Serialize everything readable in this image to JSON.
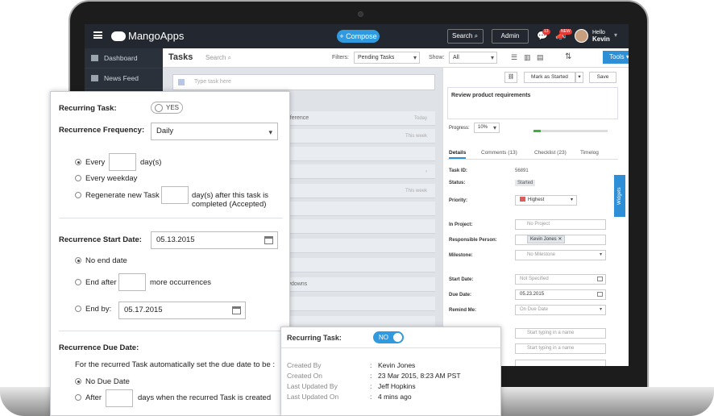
{
  "topbar": {
    "logo": "MangoApps",
    "compose": "+ Compose",
    "search": "Search",
    "admin": "Admin",
    "badge_chat": "13",
    "badge_new": "NEW",
    "hello": "Hello",
    "user": "Kevin"
  },
  "sidebar": {
    "items": [
      {
        "label": "Dashboard"
      },
      {
        "label": "News Feed"
      }
    ]
  },
  "tasks": {
    "title": "Tasks",
    "search_placeholder": "Search",
    "filters_label": "Filters:",
    "filter_value": "Pending Tasks",
    "show_label": "Show:",
    "show_value": "All",
    "tools": "Tools",
    "add_placeholder": "Type task here",
    "rows": [
      {
        "text": "onference",
        "due": "Today"
      },
      {
        "text": "",
        "due": "This week"
      },
      {
        "text": "",
        "due": ""
      },
      {
        "text": "",
        "due": "This week"
      },
      {
        "text": "owdowns",
        "due": ""
      }
    ]
  },
  "detail": {
    "mark_started": "Mark as Started",
    "save": "Save",
    "title": "Review product requirements",
    "progress_label": "Progress:",
    "progress_value": "10%",
    "progress_fraction": 0.1,
    "tabs": [
      "Details",
      "Comments (13)",
      "Checklist (23)",
      "Timelog"
    ],
    "task_id_label": "Task ID:",
    "task_id": "56891",
    "status_label": "Status:",
    "status": "Started",
    "priority_label": "Priority:",
    "priority": "Highest",
    "project_label": "In Project:",
    "project": "No Project",
    "person_label": "Responsible Person:",
    "person": "Kevin Jones",
    "milestone_label": "Milestone:",
    "milestone": "No Milestone",
    "start_label": "Start Date:",
    "start": "Not Specified",
    "due_label": "Due Date:",
    "due": "05.23.2015",
    "remind_label": "Remind Me:",
    "remind": "On Due Date",
    "typing_placeholder": "Start typing in a name",
    "widgets": "Widgets"
  },
  "recurring": {
    "task_label": "Recurring Task:",
    "task_toggle": "YES",
    "freq_label": "Recurrence Frequency:",
    "freq_value": "Daily",
    "every_label": "Every",
    "every_unit": "day(s)",
    "every_weekday": "Every weekday",
    "regen_label": "Regenerate new Task",
    "regen_unit_1": "day(s) after this task is",
    "regen_unit_2": "completed (Accepted)",
    "start_label": "Recurrence Start Date:",
    "start_value": "05.13.2015",
    "no_end": "No end date",
    "end_after": "End after",
    "more_occ": "more occurrences",
    "end_by": "End by:",
    "end_by_value": "05.17.2015",
    "due_label": "Recurrence Due Date:",
    "due_desc": "For the recurred Task automatically set the due date to be :",
    "no_due": "No Due Date",
    "after": "After",
    "after_desc": "days when the recurred Task is created"
  },
  "info": {
    "task_label": "Recurring Task:",
    "toggle": "NO",
    "rows": [
      {
        "key": "Created By",
        "value": "Kevin Jones"
      },
      {
        "key": "Created On",
        "value": "23 Mar 2015, 8:23 AM PST"
      },
      {
        "key": "Last Updated By",
        "value": "Jeff Hopkins"
      },
      {
        "key": "Last Updated On",
        "value": "4 mins ago"
      }
    ]
  }
}
